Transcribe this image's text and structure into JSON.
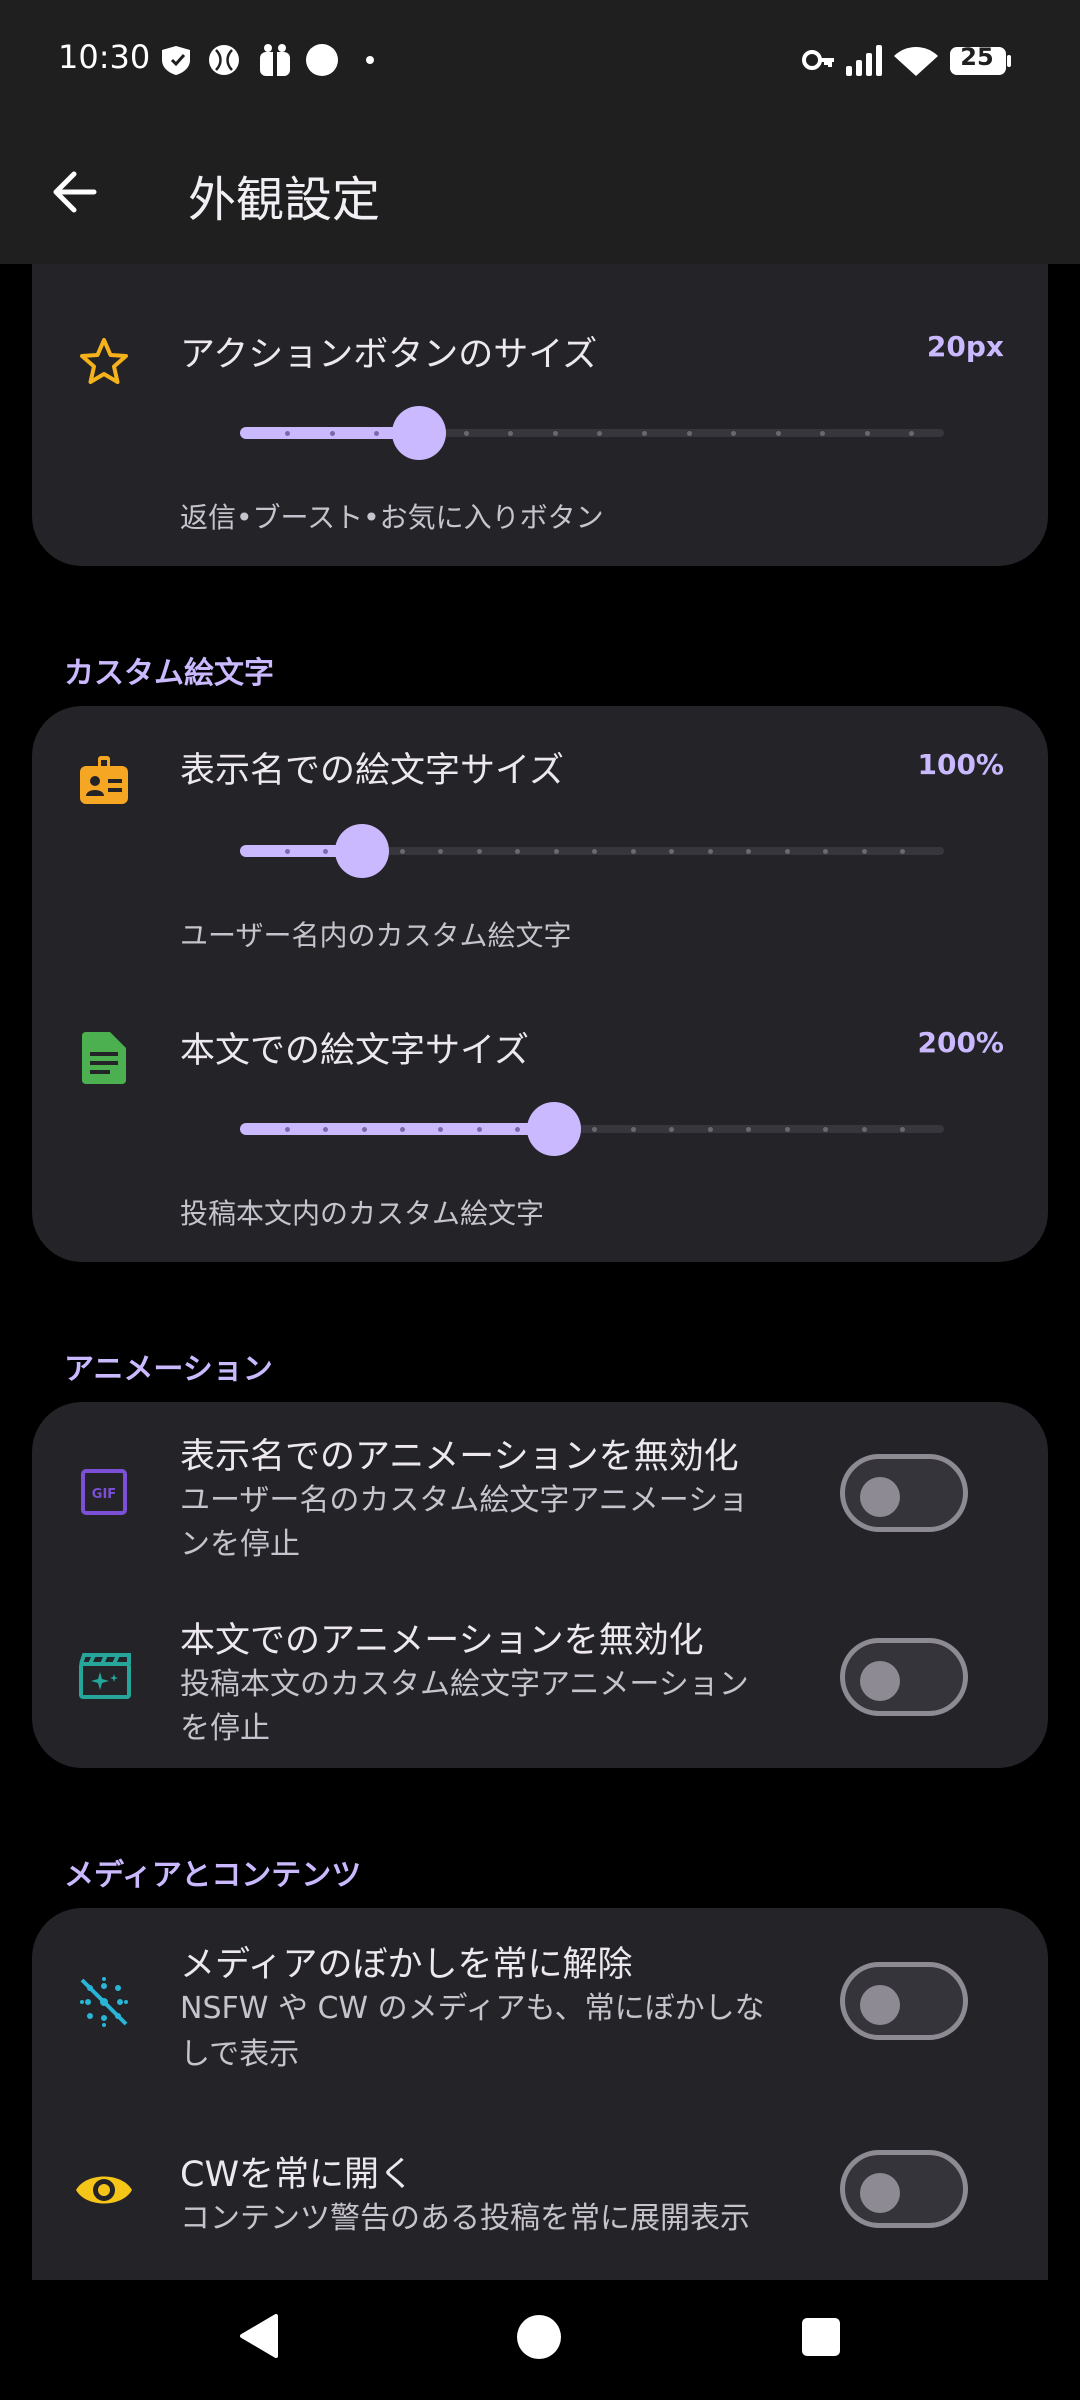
{
  "status_bar": {
    "time": "10:30",
    "battery": "25"
  },
  "app_bar": {
    "title": "外観設定"
  },
  "action_buttons": {
    "title": "アクションボタンのサイズ",
    "value": "20px",
    "subtitle": "返信•ブースト•お気に入りボタン",
    "level": 0.25
  },
  "custom_emoji": {
    "header": "カスタム絵文字",
    "display_name": {
      "title": "表示名での絵文字サイズ",
      "value": "100%",
      "subtitle": "ユーザー名内のカスタム絵文字",
      "level": 0.17
    },
    "body": {
      "title": "本文での絵文字サイズ",
      "value": "200%",
      "subtitle": "投稿本文内のカスタム絵文字",
      "level": 0.44
    }
  },
  "animation": {
    "header": "アニメーション",
    "display_name": {
      "title": "表示名でのアニメーションを無効化",
      "subtitle_line1": "ユーザー名のカスタム絵文字アニメーショ",
      "subtitle_line2": "ンを停止",
      "on": false
    },
    "body": {
      "title": "本文でのアニメーションを無効化",
      "subtitle_line1": "投稿本文のカスタム絵文字アニメーション",
      "subtitle_line2": "を停止",
      "on": false
    }
  },
  "media": {
    "header": "メディアとコンテンツ",
    "unblur": {
      "title": "メディアのぼかしを常に解除",
      "subtitle_line1": "NSFW や CW のメディアも、常にぼかしな",
      "subtitle_line2": "しで表示",
      "on": false
    },
    "cw_open": {
      "title": "CWを常に開く",
      "subtitle": "コンテンツ警告のある投稿を常に展開表示",
      "on": false
    }
  },
  "icons": {
    "back": "back-arrow-icon",
    "star": "star-icon",
    "badge": "badge-icon",
    "article": "article-icon",
    "gif": "gif-icon",
    "movie": "movie-sparkle-icon",
    "blur_off": "blur-off-icon",
    "eye": "eye-icon"
  },
  "colors": {
    "accent": "#cbb9ff",
    "star": "#f5b21b",
    "badge": "#f5a623",
    "article": "#4caf50",
    "gif": "#7b4fd6",
    "movie": "#26a69a",
    "blur": "#29b6d6",
    "eye": "#f5c518"
  }
}
